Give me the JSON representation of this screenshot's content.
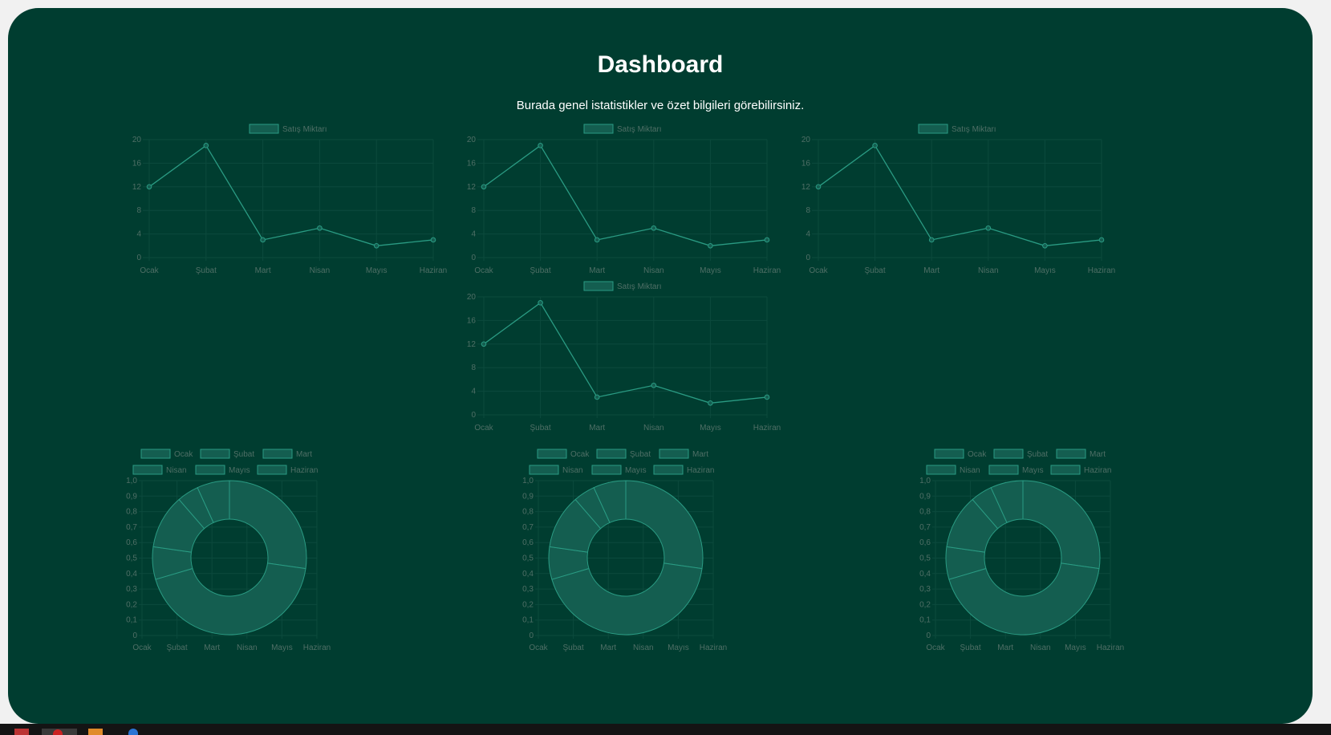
{
  "page": {
    "title": "Dashboard",
    "subtitle": "Burada genel istatistikler ve özet bilgileri görebilirsiniz."
  },
  "colors": {
    "background": "#003d30",
    "outer_background": "#f1f1f1",
    "series_line": "#2a9b83",
    "series_fill": "#145e50",
    "axis_text": "#4f6f66",
    "grid": "#0c4a3d",
    "taskbar": "#141414"
  },
  "taskbar": {
    "icons": [
      "app-icon-red",
      "browser-icon",
      "folder-icon",
      "edge-icon"
    ]
  },
  "chart_data": [
    {
      "type": "line",
      "legend": [
        "Satış Miktarı"
      ],
      "categories": [
        "Ocak",
        "Şubat",
        "Mart",
        "Nisan",
        "Mayıs",
        "Haziran"
      ],
      "series": [
        {
          "name": "Satış Miktarı",
          "values": [
            12,
            19,
            3,
            5,
            2,
            3
          ]
        }
      ],
      "ylim": [
        0,
        20
      ],
      "yticks": [
        "0",
        "4",
        "8",
        "12",
        "16",
        "20"
      ],
      "grid": true,
      "legend_position": "top"
    },
    {
      "type": "line",
      "legend": [
        "Satış Miktarı"
      ],
      "categories": [
        "Ocak",
        "Şubat",
        "Mart",
        "Nisan",
        "Mayıs",
        "Haziran"
      ],
      "series": [
        {
          "name": "Satış Miktarı",
          "values": [
            12,
            19,
            3,
            5,
            2,
            3
          ]
        }
      ],
      "ylim": [
        0,
        20
      ],
      "yticks": [
        "0",
        "4",
        "8",
        "12",
        "16",
        "20"
      ],
      "grid": true,
      "legend_position": "top"
    },
    {
      "type": "line",
      "legend": [
        "Satış Miktarı"
      ],
      "categories": [
        "Ocak",
        "Şubat",
        "Mart",
        "Nisan",
        "Mayıs",
        "Haziran"
      ],
      "series": [
        {
          "name": "Satış Miktarı",
          "values": [
            12,
            19,
            3,
            5,
            2,
            3
          ]
        }
      ],
      "ylim": [
        0,
        20
      ],
      "yticks": [
        "0",
        "4",
        "8",
        "12",
        "16",
        "20"
      ],
      "grid": true,
      "legend_position": "top"
    },
    {
      "type": "line",
      "legend": [
        "Satış Miktarı"
      ],
      "categories": [
        "Ocak",
        "Şubat",
        "Mart",
        "Nisan",
        "Mayıs",
        "Haziran"
      ],
      "series": [
        {
          "name": "Satış Miktarı",
          "values": [
            12,
            19,
            3,
            5,
            2,
            3
          ]
        }
      ],
      "ylim": [
        0,
        20
      ],
      "yticks": [
        "0",
        "4",
        "8",
        "12",
        "16",
        "20"
      ],
      "grid": true,
      "legend_position": "top"
    },
    {
      "type": "pie",
      "variant": "doughnut",
      "legend": [
        "Ocak",
        "Şubat",
        "Mart",
        "Nisan",
        "Mayıs",
        "Haziran"
      ],
      "categories": [
        "Ocak",
        "Şubat",
        "Mart",
        "Nisan",
        "Mayıs",
        "Haziran"
      ],
      "values": [
        12,
        19,
        3,
        5,
        2,
        3
      ],
      "yticks": [
        "0",
        "0,1",
        "0,2",
        "0,3",
        "0,4",
        "0,5",
        "0,6",
        "0,7",
        "0,8",
        "0,9",
        "1,0"
      ],
      "xticks": [
        "Ocak",
        "Şubat",
        "Mart",
        "Nisan",
        "Mayıs",
        "Haziran"
      ],
      "ylim": [
        0,
        1
      ],
      "legend_position": "top"
    },
    {
      "type": "pie",
      "variant": "doughnut",
      "legend": [
        "Ocak",
        "Şubat",
        "Mart",
        "Nisan",
        "Mayıs",
        "Haziran"
      ],
      "categories": [
        "Ocak",
        "Şubat",
        "Mart",
        "Nisan",
        "Mayıs",
        "Haziran"
      ],
      "values": [
        12,
        19,
        3,
        5,
        2,
        3
      ],
      "yticks": [
        "0",
        "0,1",
        "0,2",
        "0,3",
        "0,4",
        "0,5",
        "0,6",
        "0,7",
        "0,8",
        "0,9",
        "1,0"
      ],
      "xticks": [
        "Ocak",
        "Şubat",
        "Mart",
        "Nisan",
        "Mayıs",
        "Haziran"
      ],
      "ylim": [
        0,
        1
      ],
      "legend_position": "top"
    },
    {
      "type": "pie",
      "variant": "doughnut",
      "legend": [
        "Ocak",
        "Şubat",
        "Mart",
        "Nisan",
        "Mayıs",
        "Haziran"
      ],
      "categories": [
        "Ocak",
        "Şubat",
        "Mart",
        "Nisan",
        "Mayıs",
        "Haziran"
      ],
      "values": [
        12,
        19,
        3,
        5,
        2,
        3
      ],
      "yticks": [
        "0",
        "0,1",
        "0,2",
        "0,3",
        "0,4",
        "0,5",
        "0,6",
        "0,7",
        "0,8",
        "0,9",
        "1,0"
      ],
      "xticks": [
        "Ocak",
        "Şubat",
        "Mart",
        "Nisan",
        "Mayıs",
        "Haziran"
      ],
      "ylim": [
        0,
        1
      ],
      "legend_position": "top"
    }
  ]
}
